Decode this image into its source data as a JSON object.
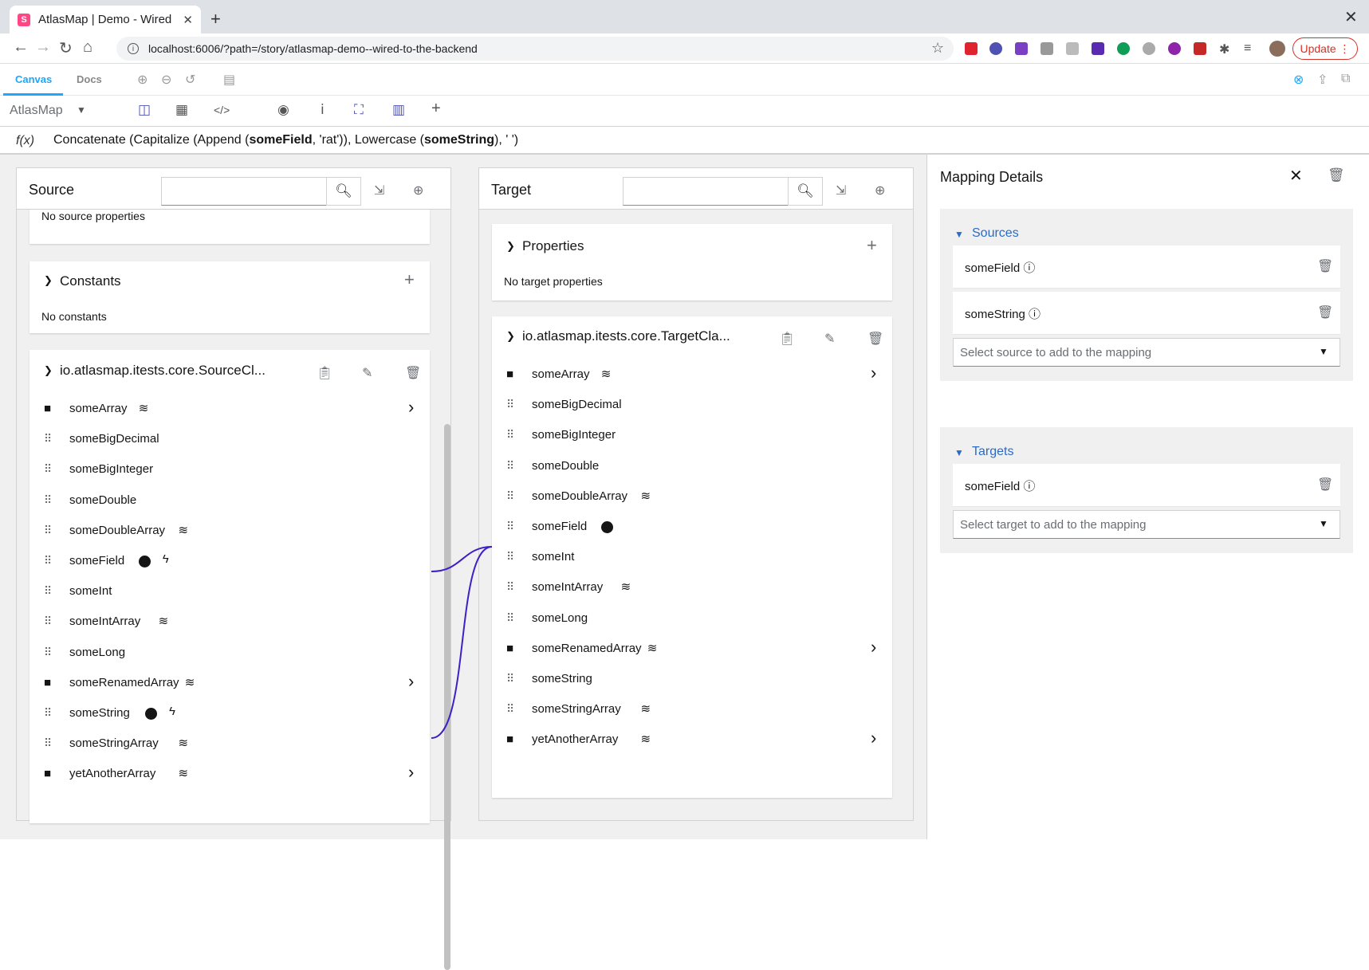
{
  "browser": {
    "tab_title": "AtlasMap | Demo - Wired",
    "tab_favicon_letter": "S",
    "url": "localhost:6006/?path=/story/atlasmap-demo--wired-to-the-backend",
    "update_label": "Update"
  },
  "storybook": {
    "tab_canvas": "Canvas",
    "tab_docs": "Docs"
  },
  "atlasmap": {
    "title": "AtlasMap"
  },
  "expression": {
    "fx": "f(x)",
    "parts": [
      {
        "text": "Concatenate (Capitalize (Append (",
        "bold": false
      },
      {
        "text": "someField",
        "bold": true
      },
      {
        "text": ", 'rat')), Lowercase (",
        "bold": false
      },
      {
        "text": "someString",
        "bold": true
      },
      {
        "text": "), ' ')",
        "bold": false
      }
    ]
  },
  "source": {
    "title": "Source",
    "no_props": "No source properties",
    "constants_title": "Constants",
    "no_constants": "No constants",
    "class_title": "io.atlasmap.itests.core.SourceCl...",
    "fields": [
      {
        "name": "someArray",
        "kind": "folder",
        "collection": true,
        "expand": true
      },
      {
        "name": "someBigDecimal",
        "kind": "field"
      },
      {
        "name": "someBigInteger",
        "kind": "field"
      },
      {
        "name": "someDouble",
        "kind": "field"
      },
      {
        "name": "someDoubleArray",
        "kind": "field",
        "collection": true
      },
      {
        "name": "someField",
        "kind": "field",
        "mapped": true,
        "transformation": true
      },
      {
        "name": "someInt",
        "kind": "field"
      },
      {
        "name": "someIntArray",
        "kind": "field",
        "collection": true
      },
      {
        "name": "someLong",
        "kind": "field"
      },
      {
        "name": "someRenamedArray",
        "kind": "folder",
        "collection": true,
        "expand": true
      },
      {
        "name": "someString",
        "kind": "field",
        "mapped": true,
        "transformation": true
      },
      {
        "name": "someStringArray",
        "kind": "field",
        "collection": true
      },
      {
        "name": "yetAnotherArray",
        "kind": "folder",
        "collection": true,
        "expand": true
      }
    ]
  },
  "target": {
    "title": "Target",
    "properties_title": "Properties",
    "no_props": "No target properties",
    "class_title": "io.atlasmap.itests.core.TargetCla...",
    "fields": [
      {
        "name": "someArray",
        "kind": "folder",
        "collection": true,
        "expand": true
      },
      {
        "name": "someBigDecimal",
        "kind": "field"
      },
      {
        "name": "someBigInteger",
        "kind": "field"
      },
      {
        "name": "someDouble",
        "kind": "field"
      },
      {
        "name": "someDoubleArray",
        "kind": "field",
        "collection": true
      },
      {
        "name": "someField",
        "kind": "field",
        "mapped": true
      },
      {
        "name": "someInt",
        "kind": "field"
      },
      {
        "name": "someIntArray",
        "kind": "field",
        "collection": true
      },
      {
        "name": "someLong",
        "kind": "field"
      },
      {
        "name": "someRenamedArray",
        "kind": "folder",
        "collection": true,
        "expand": true
      },
      {
        "name": "someString",
        "kind": "field"
      },
      {
        "name": "someStringArray",
        "kind": "field",
        "collection": true
      },
      {
        "name": "yetAnotherArray",
        "kind": "folder",
        "collection": true,
        "expand": true
      }
    ]
  },
  "details": {
    "title": "Mapping Details",
    "sources_title": "Sources",
    "sources": [
      "someField",
      "someString"
    ],
    "source_select_placeholder": "Select source to add to the mapping",
    "targets_title": "Targets",
    "targets": [
      "someField"
    ],
    "target_select_placeholder": "Select target to add to the mapping"
  },
  "colors": {
    "accent": "#1ea7fd",
    "link_line": "#3f1fc7",
    "section_title": "#2b6bc4"
  }
}
